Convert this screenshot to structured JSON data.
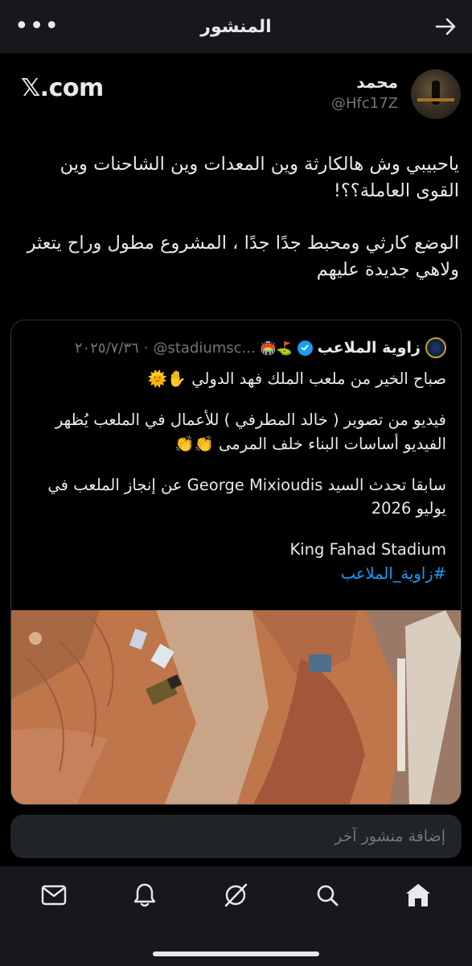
{
  "header": {
    "title": "المنشور",
    "more_icon": "more-horizontal-icon",
    "back_icon": "arrow-right-icon"
  },
  "source_label": "𝕏.com",
  "author": {
    "name": "محمد",
    "handle": "@Hfc17Z"
  },
  "post": {
    "text": "ياحبيبي وش هالكارثة وين المعدات وين الشاحنات وين القوى العاملة؟؟!\n\nالوضع كارثي ومحبط جدًا جدًا ، المشروع مطول وراح يتعثر ولاهي جديدة عليهم"
  },
  "quote": {
    "name": "زاوية الملاعب",
    "emojis": "⛳🏟️",
    "handle": "@stadiumsc...",
    "separator": "·",
    "date": "٢٠٢٥/٧/٣٦",
    "line1": "صباح الخير من ملعب الملك فهد الدولي ✋🌞",
    "line2": "فيديو من تصوير ( خالد المطرفي ) للأعمال في الملعب يُظهر الفيديو أساسات البناء خلف المرمى 👏👏",
    "line3": "سابقا تحدث السيد George Mixioudis عن إنجاز الملعب في يوليو 2026",
    "line4": "King Fahad Stadium",
    "hashtag": "#زاوية_الملاعب"
  },
  "reply": {
    "placeholder": "إضافة منشور آخر"
  },
  "nav": {
    "items": [
      "mail-icon",
      "bell-icon",
      "grok-icon",
      "search-icon",
      "home-icon"
    ]
  },
  "colors": {
    "accent": "#1d9bf0",
    "background": "#000000",
    "secondary_text": "#71767b",
    "bar_background": "#16181c"
  }
}
